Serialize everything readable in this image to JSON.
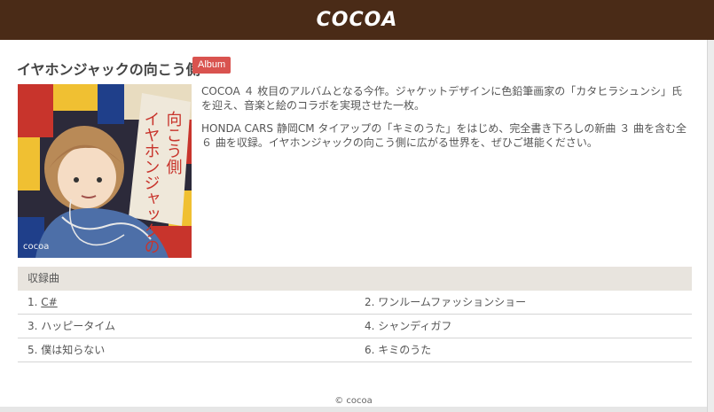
{
  "header": {
    "title": "COCOA"
  },
  "album": {
    "title": "イヤホンジャックの向こう側",
    "badge": "Album",
    "cover_alt": "イヤホンジャックの向こう側",
    "description": [
      "COCOA ４ 枚目のアルバムとなる今作。ジャケットデザインに色鉛筆画家の「カタヒラシュンシ」氏を迎え、音楽と絵のコラボを実現させた一枚。",
      "HONDA CARS 静岡CM タイアップの「キミのうた」をはじめ、完全書き下ろしの新曲 ３ 曲を含む全 ６ 曲を収録。イヤホンジャックの向こう側に広がる世界を、ぜひご堪能ください。"
    ]
  },
  "tracklist": {
    "header": "収録曲",
    "rows": [
      [
        {
          "label": "1. ",
          "title": "C#",
          "link": true
        },
        {
          "label": "2. ",
          "title": "ワンルームファッションショー",
          "link": false
        }
      ],
      [
        {
          "label": "3. ",
          "title": "ハッピータイム",
          "link": false
        },
        {
          "label": "4. ",
          "title": "シャンディガフ",
          "link": false
        }
      ],
      [
        {
          "label": "5. ",
          "title": "僕は知らない",
          "link": false
        },
        {
          "label": "6. ",
          "title": "キミのうた",
          "link": false
        }
      ]
    ]
  },
  "footer": {
    "copyright": "© cocoa"
  },
  "colors": {
    "header_bg": "#4a2b17",
    "badge_bg": "#d9534f",
    "table_header_bg": "#e8e4de"
  }
}
